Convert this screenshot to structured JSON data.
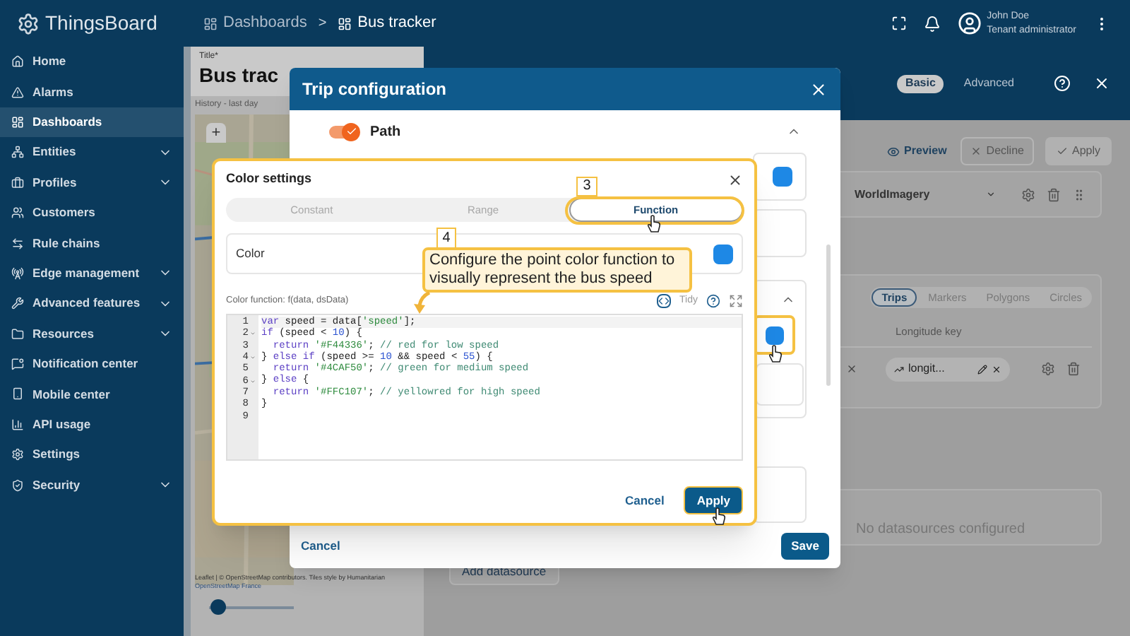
{
  "app": {
    "name": "ThingsBoard"
  },
  "breadcrumbs": {
    "separator": ">",
    "items": [
      {
        "label": "Dashboards",
        "current": false
      },
      {
        "label": "Bus tracker",
        "current": true
      }
    ]
  },
  "user": {
    "name": "John Doe",
    "role": "Tenant administrator"
  },
  "sidebar": {
    "items": [
      {
        "label": "Home",
        "selected": false,
        "expandable": false
      },
      {
        "label": "Alarms",
        "selected": false,
        "expandable": false
      },
      {
        "label": "Dashboards",
        "selected": true,
        "expandable": false
      },
      {
        "label": "Entities",
        "selected": false,
        "expandable": true
      },
      {
        "label": "Profiles",
        "selected": false,
        "expandable": true
      },
      {
        "label": "Customers",
        "selected": false,
        "expandable": false
      },
      {
        "label": "Rule chains",
        "selected": false,
        "expandable": false
      },
      {
        "label": "Edge management",
        "selected": false,
        "expandable": true
      },
      {
        "label": "Advanced features",
        "selected": false,
        "expandable": true
      },
      {
        "label": "Resources",
        "selected": false,
        "expandable": true
      },
      {
        "label": "Notification center",
        "selected": false,
        "expandable": false
      },
      {
        "label": "Mobile center",
        "selected": false,
        "expandable": false
      },
      {
        "label": "API usage",
        "selected": false,
        "expandable": false
      },
      {
        "label": "Settings",
        "selected": false,
        "expandable": false
      },
      {
        "label": "Security",
        "selected": false,
        "expandable": true
      }
    ]
  },
  "dashboard": {
    "title_label": "Title*",
    "title": "Bus trac",
    "widget_title": "History - last day",
    "zoom_in": "+",
    "attribution": "Leaflet | © OpenStreetMap contributors. Tiles style by Humanitarian",
    "attribution_2": "OpenStreetMap France",
    "timeline": {
      "level": 0.02
    }
  },
  "editor": {
    "modes": [
      {
        "label": "Basic",
        "selected": true
      },
      {
        "label": "Advanced",
        "selected": false
      }
    ],
    "actions": [
      {
        "label": "Preview",
        "kind": "link"
      },
      {
        "label": "Decline",
        "kind": "outlined"
      },
      {
        "label": "Apply",
        "kind": "filled"
      }
    ],
    "map_layer": "WorldImagery",
    "data_tabs": [
      {
        "label": "Trips",
        "selected": true
      },
      {
        "label": "Markers",
        "selected": false
      },
      {
        "label": "Polygons",
        "selected": false
      },
      {
        "label": "Circles",
        "selected": false
      }
    ],
    "column_header": "Longitude key",
    "key_chip": "longit...",
    "empty_message": "No datasources configured",
    "add_button": "Add datasource"
  },
  "trip_dialog": {
    "title": "Trip configuration",
    "path": {
      "label": "Path",
      "on": true
    },
    "cancel": "Cancel",
    "save": "Save"
  },
  "color_dialog": {
    "title": "Color settings",
    "tabs": [
      {
        "label": "Constant",
        "selected": false
      },
      {
        "label": "Range",
        "selected": false
      },
      {
        "label": "Function",
        "selected": true
      }
    ],
    "color_label": "Color",
    "function_label": "Color function: f(data, dsData)",
    "tidy": "Tidy",
    "code_lines": [
      {
        "number": "1",
        "fold": false,
        "tokens": [
          {
            "kind": "keyword",
            "text": "var"
          },
          {
            "kind": "plain",
            "text": " speed = data["
          },
          {
            "kind": "string",
            "text": "'speed'"
          },
          {
            "kind": "plain",
            "text": "];"
          }
        ]
      },
      {
        "number": "2",
        "fold": true,
        "tokens": [
          {
            "kind": "keyword",
            "text": "if"
          },
          {
            "kind": "plain",
            "text": " (speed < "
          },
          {
            "kind": "number",
            "text": "10"
          },
          {
            "kind": "plain",
            "text": ") {"
          }
        ]
      },
      {
        "number": "3",
        "fold": false,
        "tokens": [
          {
            "kind": "keyword",
            "text": "  return"
          },
          {
            "kind": "string",
            "text": " '#F44336'"
          },
          {
            "kind": "plain",
            "text": ";"
          },
          {
            "kind": "comment",
            "text": " // red for low speed"
          }
        ]
      },
      {
        "number": "4",
        "fold": true,
        "tokens": [
          {
            "kind": "plain",
            "text": "} "
          },
          {
            "kind": "keyword",
            "text": "else if"
          },
          {
            "kind": "plain",
            "text": " (speed >= "
          },
          {
            "kind": "number",
            "text": "10"
          },
          {
            "kind": "plain",
            "text": " && speed < "
          },
          {
            "kind": "number",
            "text": "55"
          },
          {
            "kind": "plain",
            "text": ") {"
          }
        ]
      },
      {
        "number": "5",
        "fold": false,
        "tokens": [
          {
            "kind": "keyword",
            "text": "  return"
          },
          {
            "kind": "string",
            "text": " '#4CAF50'"
          },
          {
            "kind": "plain",
            "text": ";"
          },
          {
            "kind": "comment",
            "text": " // green for medium speed"
          }
        ]
      },
      {
        "number": "6",
        "fold": true,
        "tokens": [
          {
            "kind": "plain",
            "text": "} "
          },
          {
            "kind": "keyword",
            "text": "else"
          },
          {
            "kind": "plain",
            "text": " {"
          }
        ]
      },
      {
        "number": "7",
        "fold": false,
        "tokens": [
          {
            "kind": "keyword",
            "text": "  return"
          },
          {
            "kind": "string",
            "text": " '#FFC107'"
          },
          {
            "kind": "plain",
            "text": ";"
          },
          {
            "kind": "comment",
            "text": " // yellowred for high speed"
          }
        ]
      },
      {
        "number": "8",
        "fold": false,
        "tokens": [
          {
            "kind": "plain",
            "text": "}"
          }
        ]
      },
      {
        "number": "9",
        "fold": false
      }
    ],
    "cancel": "Cancel",
    "apply": "Apply"
  },
  "tutorial": {
    "steps": [
      {
        "number": "3"
      },
      {
        "number": "4",
        "text": "Configure the point color function to visually represent the bus speed"
      }
    ]
  }
}
